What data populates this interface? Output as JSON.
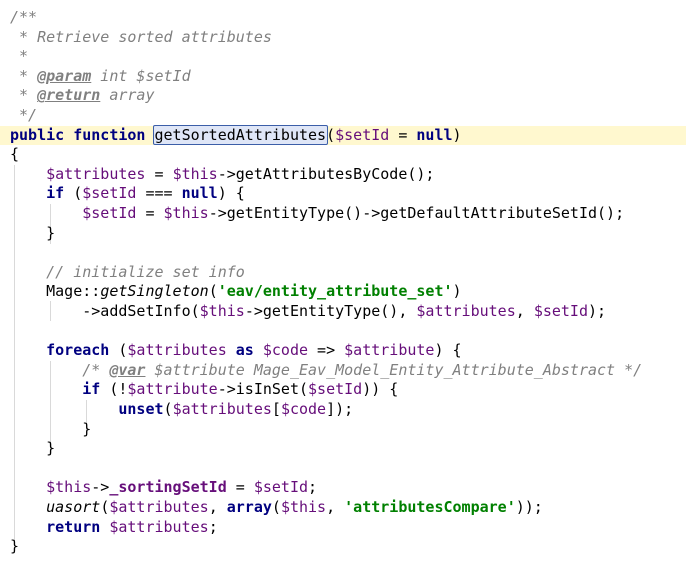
{
  "editor": {
    "lines": [
      {
        "segs": [
          {
            "t": "/**",
            "c": "c"
          }
        ]
      },
      {
        "segs": [
          {
            "t": " * Retrieve sorted attributes",
            "c": "c"
          }
        ]
      },
      {
        "segs": [
          {
            "t": " *",
            "c": "c"
          }
        ]
      },
      {
        "segs": [
          {
            "t": " * ",
            "c": "c"
          },
          {
            "t": "@param",
            "c": "t"
          },
          {
            "t": " int $setId",
            "c": "c"
          }
        ]
      },
      {
        "segs": [
          {
            "t": " * ",
            "c": "c"
          },
          {
            "t": "@return",
            "c": "t"
          },
          {
            "t": " array",
            "c": "c"
          }
        ]
      },
      {
        "segs": [
          {
            "t": " */",
            "c": "c"
          }
        ]
      },
      {
        "hl": true,
        "segs": [
          {
            "t": "public function ",
            "c": "k"
          },
          {
            "t": "getSortedAttributes",
            "c": "sel"
          },
          {
            "t": "(",
            "c": ""
          },
          {
            "t": "$setId",
            "c": "v"
          },
          {
            "t": " = ",
            "c": ""
          },
          {
            "t": "null",
            "c": "k"
          },
          {
            "t": ")",
            "c": ""
          }
        ]
      },
      {
        "segs": [
          {
            "t": "{",
            "c": ""
          }
        ]
      },
      {
        "segs": [
          {
            "t": "    ",
            "c": ""
          },
          {
            "t": "$attributes",
            "c": "v"
          },
          {
            "t": " = ",
            "c": ""
          },
          {
            "t": "$this",
            "c": "v"
          },
          {
            "t": "->getAttributesByCode();",
            "c": ""
          }
        ]
      },
      {
        "segs": [
          {
            "t": "    ",
            "c": ""
          },
          {
            "t": "if",
            "c": "k"
          },
          {
            "t": " (",
            "c": ""
          },
          {
            "t": "$setId",
            "c": "v"
          },
          {
            "t": " === ",
            "c": ""
          },
          {
            "t": "null",
            "c": "k"
          },
          {
            "t": ") {",
            "c": ""
          }
        ]
      },
      {
        "segs": [
          {
            "t": "        ",
            "c": ""
          },
          {
            "t": "$setId",
            "c": "v"
          },
          {
            "t": " = ",
            "c": ""
          },
          {
            "t": "$this",
            "c": "v"
          },
          {
            "t": "->getEntityType()->getDefaultAttributeSetId();",
            "c": ""
          }
        ]
      },
      {
        "segs": [
          {
            "t": "    }",
            "c": ""
          }
        ]
      },
      {
        "segs": [
          {
            "t": "",
            "c": ""
          }
        ]
      },
      {
        "segs": [
          {
            "t": "    ",
            "c": ""
          },
          {
            "t": "// initialize set info",
            "c": "c"
          }
        ]
      },
      {
        "segs": [
          {
            "t": "    Mage::",
            "c": ""
          },
          {
            "t": "getSingleton",
            "c": "it"
          },
          {
            "t": "(",
            "c": ""
          },
          {
            "t": "'eav/entity_attribute_set'",
            "c": "s"
          },
          {
            "t": ")",
            "c": ""
          }
        ]
      },
      {
        "segs": [
          {
            "t": "        ->addSetInfo(",
            "c": ""
          },
          {
            "t": "$this",
            "c": "v"
          },
          {
            "t": "->getEntityType(), ",
            "c": ""
          },
          {
            "t": "$attributes",
            "c": "v"
          },
          {
            "t": ", ",
            "c": ""
          },
          {
            "t": "$setId",
            "c": "v"
          },
          {
            "t": ");",
            "c": ""
          }
        ]
      },
      {
        "segs": [
          {
            "t": "",
            "c": ""
          }
        ]
      },
      {
        "segs": [
          {
            "t": "    ",
            "c": ""
          },
          {
            "t": "foreach",
            "c": "k"
          },
          {
            "t": " (",
            "c": ""
          },
          {
            "t": "$attributes",
            "c": "v"
          },
          {
            "t": " ",
            "c": ""
          },
          {
            "t": "as",
            "c": "k"
          },
          {
            "t": " ",
            "c": ""
          },
          {
            "t": "$code",
            "c": "v"
          },
          {
            "t": " => ",
            "c": ""
          },
          {
            "t": "$attribute",
            "c": "v"
          },
          {
            "t": ") {",
            "c": ""
          }
        ]
      },
      {
        "segs": [
          {
            "t": "        ",
            "c": ""
          },
          {
            "t": "/* ",
            "c": "c"
          },
          {
            "t": "@var",
            "c": "t"
          },
          {
            "t": " $attribute Mage_Eav_Model_Entity_Attribute_Abstract */",
            "c": "c"
          }
        ]
      },
      {
        "segs": [
          {
            "t": "        ",
            "c": ""
          },
          {
            "t": "if",
            "c": "k"
          },
          {
            "t": " (!",
            "c": ""
          },
          {
            "t": "$attribute",
            "c": "v"
          },
          {
            "t": "->isInSet(",
            "c": ""
          },
          {
            "t": "$setId",
            "c": "v"
          },
          {
            "t": ")) {",
            "c": ""
          }
        ]
      },
      {
        "segs": [
          {
            "t": "            ",
            "c": ""
          },
          {
            "t": "unset",
            "c": "k"
          },
          {
            "t": "(",
            "c": ""
          },
          {
            "t": "$attributes",
            "c": "v"
          },
          {
            "t": "[",
            "c": ""
          },
          {
            "t": "$code",
            "c": "v"
          },
          {
            "t": "]);",
            "c": ""
          }
        ]
      },
      {
        "segs": [
          {
            "t": "        }",
            "c": ""
          }
        ]
      },
      {
        "segs": [
          {
            "t": "    }",
            "c": ""
          }
        ]
      },
      {
        "segs": [
          {
            "t": "",
            "c": ""
          }
        ]
      },
      {
        "segs": [
          {
            "t": "    ",
            "c": ""
          },
          {
            "t": "$this",
            "c": "v"
          },
          {
            "t": "->",
            "c": ""
          },
          {
            "t": "_sortingSetId",
            "c": "v k"
          },
          {
            "t": " = ",
            "c": ""
          },
          {
            "t": "$setId",
            "c": "v"
          },
          {
            "t": ";",
            "c": ""
          }
        ]
      },
      {
        "segs": [
          {
            "t": "    ",
            "c": ""
          },
          {
            "t": "uasort",
            "c": "it"
          },
          {
            "t": "(",
            "c": ""
          },
          {
            "t": "$attributes",
            "c": "v"
          },
          {
            "t": ", ",
            "c": ""
          },
          {
            "t": "array",
            "c": "k"
          },
          {
            "t": "(",
            "c": ""
          },
          {
            "t": "$this",
            "c": "v"
          },
          {
            "t": ", ",
            "c": ""
          },
          {
            "t": "'attributesCompare'",
            "c": "s"
          },
          {
            "t": "));",
            "c": ""
          }
        ]
      },
      {
        "segs": [
          {
            "t": "    ",
            "c": ""
          },
          {
            "t": "return",
            "c": "k"
          },
          {
            "t": " ",
            "c": ""
          },
          {
            "t": "$attributes",
            "c": "v"
          },
          {
            "t": ";",
            "c": ""
          }
        ]
      },
      {
        "segs": [
          {
            "t": "}",
            "c": ""
          }
        ]
      }
    ]
  }
}
